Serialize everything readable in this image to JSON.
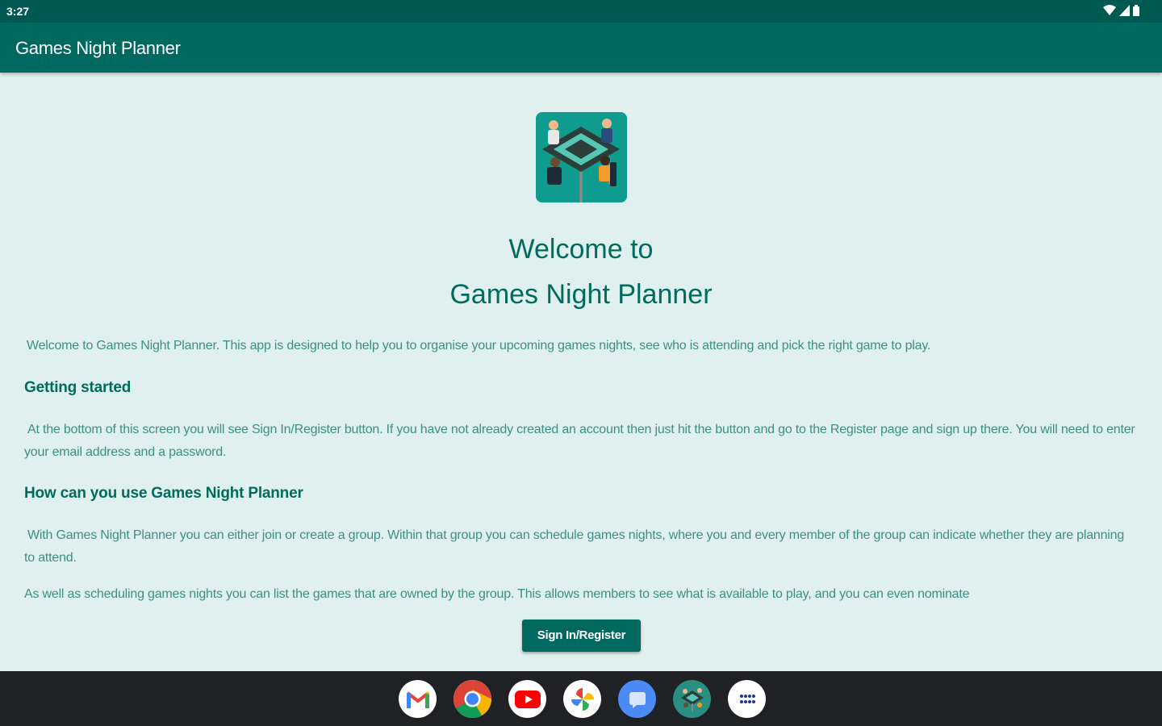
{
  "status_bar": {
    "time": "3:27"
  },
  "app_bar": {
    "title": "Games Night Planner"
  },
  "welcome": {
    "line1": "Welcome to",
    "line2": "Games Night Planner"
  },
  "intro": "Welcome to Games Night Planner. This app is designed to help you to organise your upcoming games nights, see who is attending and pick the right game to play.",
  "sections": [
    {
      "heading": "Getting started",
      "paragraphs": [
        "At the bottom of this screen you will see Sign In/Register button. If you have not already created an account then just hit the button and go to the Register page and sign up there. You will need to enter your email address and a password."
      ]
    },
    {
      "heading": "How can you use Games Night Planner",
      "paragraphs": [
        "With Games Night Planner you can either join or create a group. Within that group you can schedule games nights, where you and every member of the group can indicate whether they are planning to attend.",
        "As well as scheduling games nights you can list the games that are owned by the group. This allows members to see what is available to play, and you can even nominate"
      ]
    }
  ],
  "signin_button": "Sign In/Register",
  "dock": [
    {
      "icon": "gmail-icon"
    },
    {
      "icon": "chrome-icon"
    },
    {
      "icon": "youtube-icon"
    },
    {
      "icon": "photos-icon"
    },
    {
      "icon": "messages-icon"
    },
    {
      "icon": "games-night-planner-icon"
    },
    {
      "icon": "app-drawer-icon"
    }
  ],
  "colors": {
    "primary": "#00695f",
    "status_bar": "#005a52",
    "background": "#dff0ee",
    "text": "#3d8f85"
  }
}
